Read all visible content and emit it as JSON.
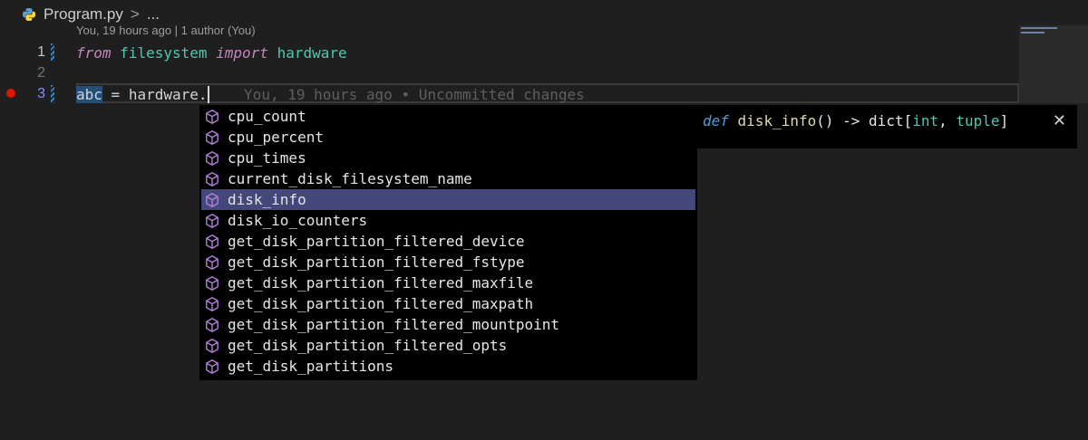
{
  "breadcrumb": {
    "file": "Program.py",
    "separator": ">",
    "more": "..."
  },
  "blame": "You, 19 hours ago | 1 author (You)",
  "lines": [
    {
      "number": "1",
      "kw1": "from",
      "module": "filesystem",
      "kw2": "import",
      "name": "hardware"
    },
    {
      "number": "2"
    },
    {
      "number": "3",
      "var": "abc",
      "assign": " = ",
      "obj": "hardware",
      "dot": ".",
      "ghost": "You, 19 hours ago • Uncommitted changes"
    }
  ],
  "suggestions": [
    "cpu_count",
    "cpu_percent",
    "cpu_times",
    "current_disk_filesystem_name",
    "disk_info",
    "disk_io_counters",
    "get_disk_partition_filtered_device",
    "get_disk_partition_filtered_fstype",
    "get_disk_partition_filtered_maxfile",
    "get_disk_partition_filtered_maxpath",
    "get_disk_partition_filtered_mountpoint",
    "get_disk_partition_filtered_opts",
    "get_disk_partitions"
  ],
  "selected_index": 4,
  "details": {
    "def": "def",
    "name": "disk_info",
    "sig_mid": "() -> dict[",
    "t1": "int",
    "comma": ", ",
    "t2": "tuple",
    "end": "]",
    "close": "✕"
  },
  "colors": {
    "accent_select": "#44477a",
    "keyword": "#c586c0",
    "type": "#4ec9b0",
    "breakpoint": "#e51400"
  },
  "icons": {
    "file": "python-icon",
    "suggestion": "symbol-method-icon"
  }
}
